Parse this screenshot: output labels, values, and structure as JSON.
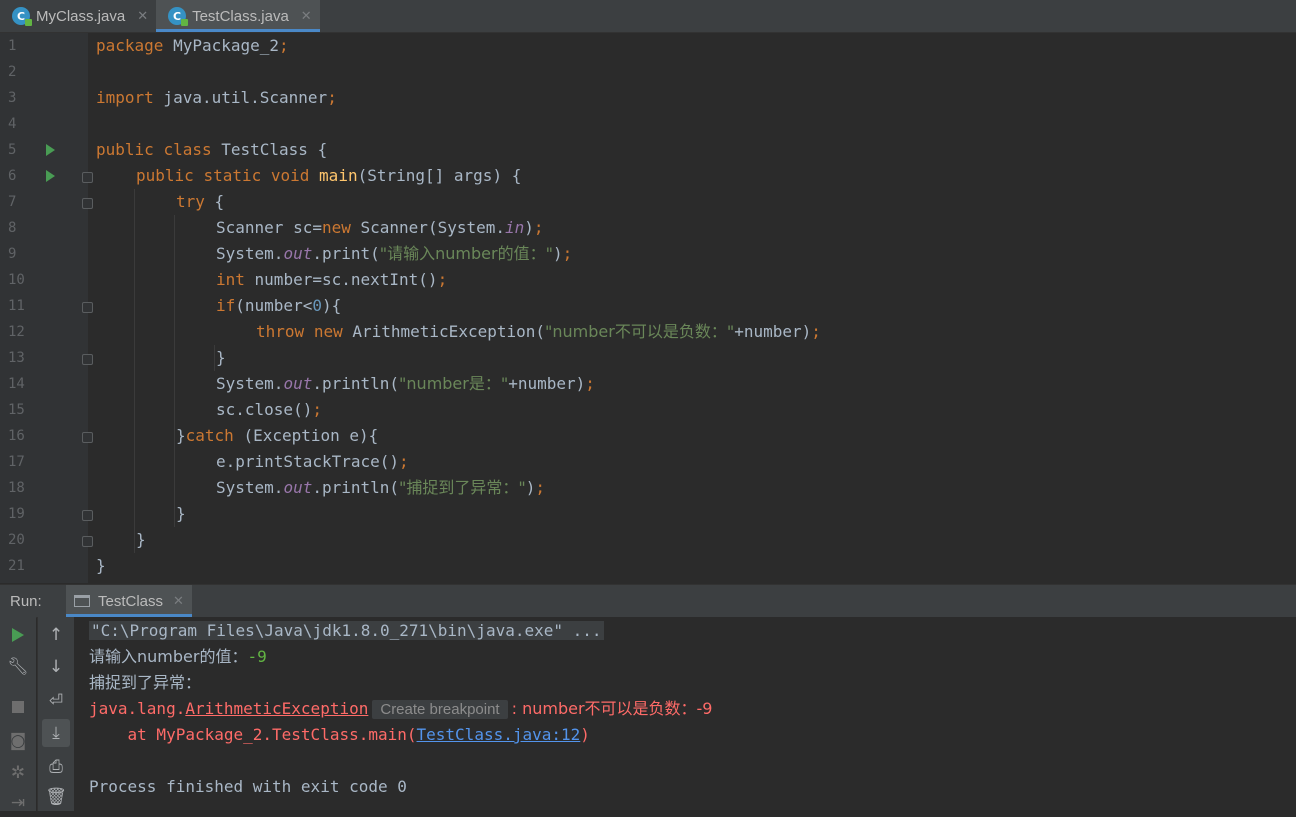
{
  "tabs": [
    {
      "label": "MyClass.java",
      "active": false
    },
    {
      "label": "TestClass.java",
      "active": true
    }
  ],
  "editor": {
    "line_numbers": [
      "1",
      "2",
      "3",
      "4",
      "5",
      "6",
      "7",
      "8",
      "9",
      "10",
      "11",
      "12",
      "13",
      "14",
      "15",
      "16",
      "17",
      "18",
      "19",
      "20",
      "21"
    ],
    "code": {
      "l1": [
        "package",
        " MyPackage_2",
        ";"
      ],
      "l3": [
        "import",
        " java.util.Scanner",
        ";"
      ],
      "l5": [
        "public",
        " ",
        "class",
        " TestClass {"
      ],
      "l6": [
        "public",
        " ",
        "static",
        " ",
        "void",
        " ",
        "main",
        "(String[] args) {"
      ],
      "l7": [
        "try",
        " {"
      ],
      "l8": [
        "Scanner sc=",
        "new",
        " Scanner(System.",
        "in",
        ")",
        ";"
      ],
      "l9": [
        "System.",
        "out",
        ".print(",
        "\"请输入number的值：\"",
        ")",
        ";"
      ],
      "l10": [
        "int",
        " number=sc.nextInt()",
        ";"
      ],
      "l11": [
        "if",
        "(number<",
        "0",
        "){"
      ],
      "l12": [
        "throw",
        " ",
        "new",
        " ArithmeticException(",
        "\"number不可以是负数：\"",
        "+number)",
        ";"
      ],
      "l13": [
        "}"
      ],
      "l14": [
        "System.",
        "out",
        ".println(",
        "\"number是：\"",
        "+number)",
        ";"
      ],
      "l15": [
        "sc.close()",
        ";"
      ],
      "l16": [
        "}",
        "catch",
        " (Exception e){"
      ],
      "l17": [
        "e.printStackTrace()",
        ";"
      ],
      "l18": [
        "System.",
        "out",
        ".println(",
        "\"捕捉到了异常：\"",
        ")",
        ";"
      ],
      "l19": [
        "}"
      ],
      "l20": [
        "}"
      ],
      "l21": [
        "}"
      ]
    }
  },
  "run_panel": {
    "label": "Run:",
    "tab_label": "TestClass",
    "console": {
      "cmd": "\"C:\\Program Files\\Java\\jdk1.8.0_271\\bin\\java.exe\" ...",
      "prompt": "请输入number的值：",
      "input": "-9",
      "caught": "捕捉到了异常：",
      "exc_pkg": "java.lang.",
      "exc_class": "ArithmeticException",
      "breakpoint_hint": "Create breakpoint",
      "exc_msg": ": number不可以是负数：-9",
      "at_prefix": "    at MyPackage_2.TestClass.main(",
      "at_link": "TestClass.java:12",
      "at_suffix": ")",
      "finished": "Process finished with exit code 0"
    }
  },
  "icons": {
    "run": "run-icon",
    "wrench": "wrench-icon",
    "stop": "stop-icon",
    "camera": "camera-icon",
    "settings": "settings-icon",
    "exit": "exit-icon",
    "up": "arrow-up-icon",
    "down": "arrow-down-icon",
    "wrap": "soft-wrap-icon",
    "scroll": "scroll-to-end-icon",
    "print": "print-icon",
    "trash": "trash-icon"
  },
  "colors": {
    "keyword": "#cc7832",
    "string": "#6a8759",
    "method": "#ffc66d",
    "number": "#6897bb",
    "field": "#9876aa",
    "error": "#ff6b68",
    "link": "#5394ec"
  }
}
